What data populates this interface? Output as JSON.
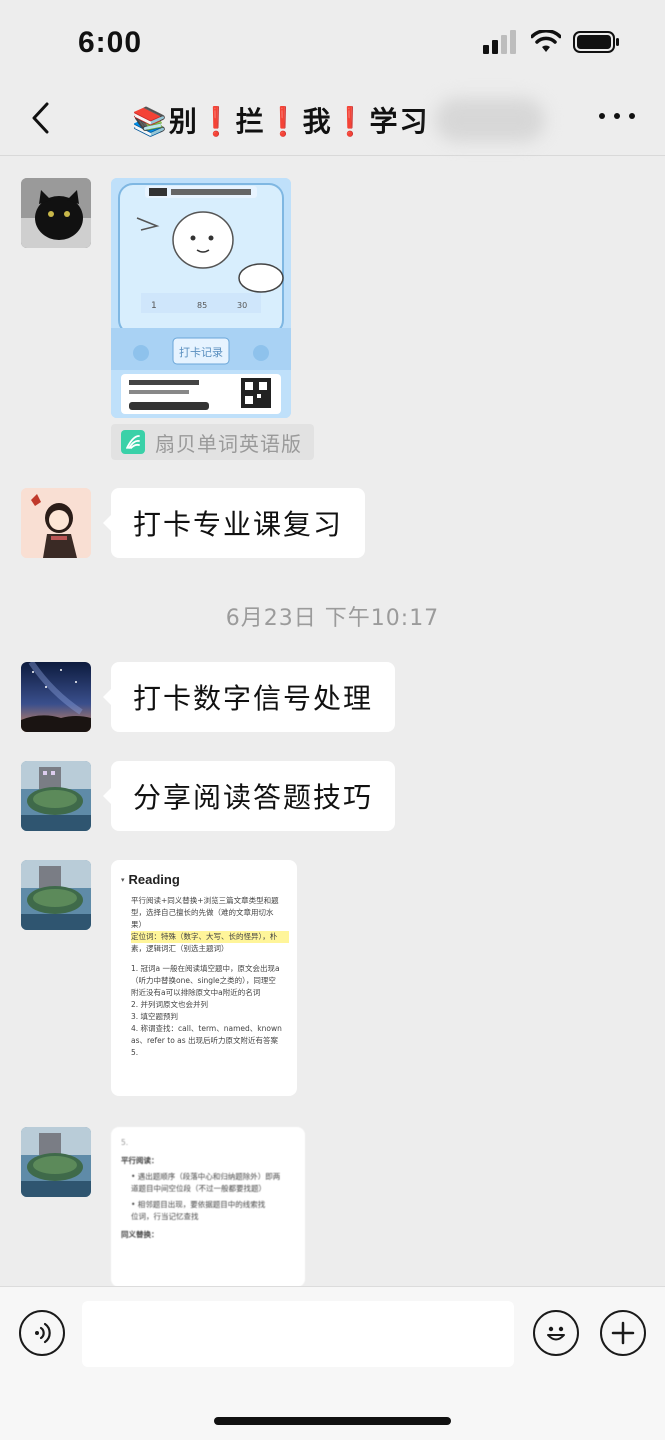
{
  "status": {
    "time": "6:00"
  },
  "nav": {
    "title": "📚别❗拦❗我❗学习"
  },
  "messages": {
    "mini_program_app": "扇贝单词英语版",
    "msg1": "打卡专业课复习",
    "timestamp": "6月23日 下午10:17",
    "msg2": "打卡数字信号处理",
    "msg3": "分享阅读答题技巧"
  },
  "doc1": {
    "title": "Reading",
    "lines": [
      "平行阅读+同义替换+浏览三篇文章类型和题",
      "型，选择自己擅长的先做（难的文章用切水",
      "果）",
      "定位词：特殊（数字、大写、长的怪异），朴",
      "素，逻辑词汇（别选主题词）",
      "1. 冠词a 一般在阅读填空题中，原文会出现a",
      "（听力中替换one、single之类的），同理空",
      "附近没有a可以排除原文中a附近的名词",
      "2. 并列词原文也会并列",
      "3. 填空题预判",
      "4. 称谓查找：call、term、named、known",
      "as、refer to as 出现后听力原文附近有答案",
      "5."
    ]
  },
  "doc2": {
    "lines": [
      "5.",
      "平行阅读：",
      "• 遇出题顺序（段落中心和归纳题除外）即两",
      "道题目中间空位段（不过一般都要找题）",
      "• 相邻题目出现，要依据题目中的线索找",
      "位词，行当记忆查找",
      "同义替换："
    ]
  }
}
